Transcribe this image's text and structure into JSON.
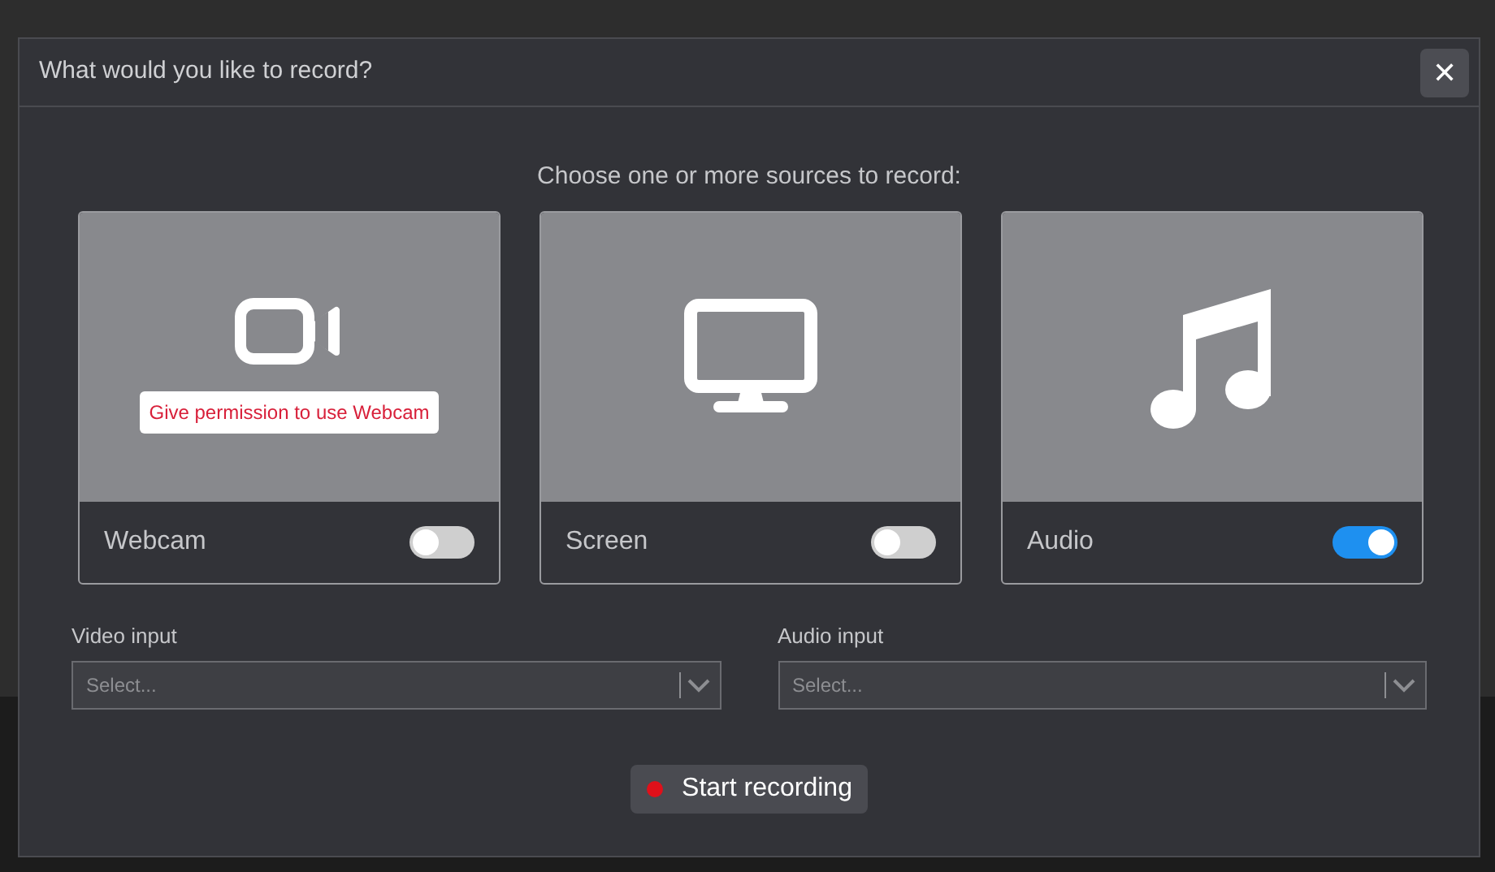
{
  "dialog": {
    "title": "What would you like to record?",
    "close_label": "✕"
  },
  "prompt": "Choose one or more sources to record:",
  "sources": [
    {
      "kind": "webcam",
      "label": "Webcam",
      "on": false,
      "notice": "Give permission to use Webcam"
    },
    {
      "kind": "screen",
      "label": "Screen",
      "on": false
    },
    {
      "kind": "audio",
      "label": "Audio",
      "on": true
    }
  ],
  "inputs": [
    {
      "label": "Video input",
      "placeholder": "Select..."
    },
    {
      "label": "Audio input",
      "placeholder": "Select..."
    }
  ],
  "start_button": {
    "label": "Start recording"
  }
}
